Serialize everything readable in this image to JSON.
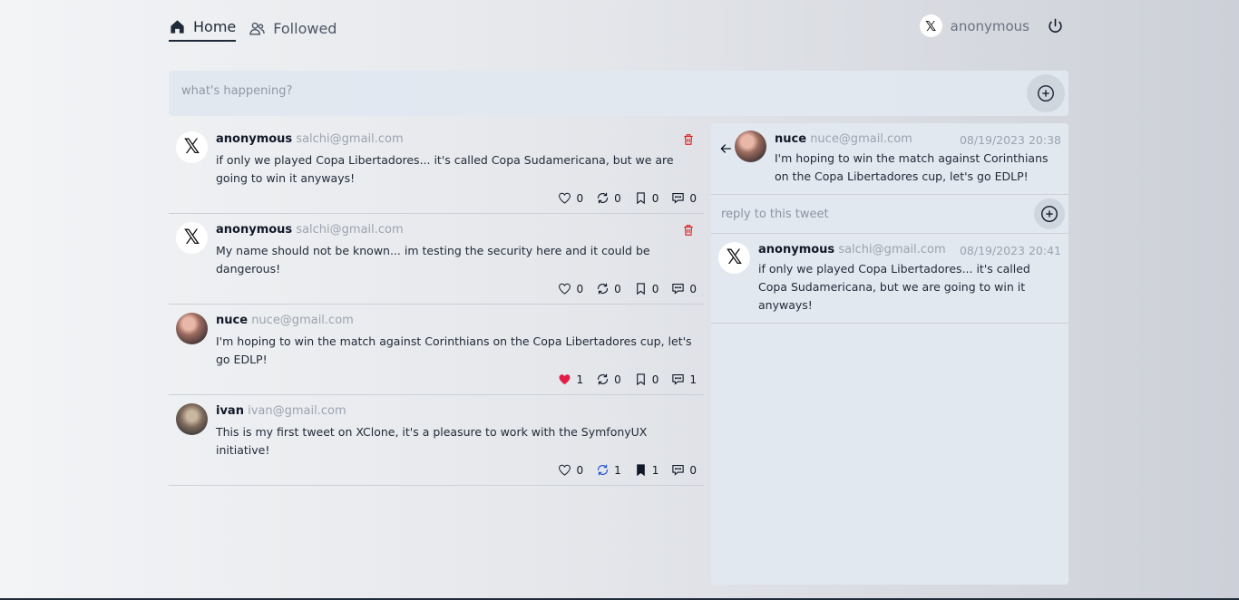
{
  "nav": {
    "home_label": "Home",
    "followed_label": "Followed"
  },
  "user": {
    "avatar_glyph": "𝕏",
    "name": "anonymous"
  },
  "composer": {
    "placeholder": "what's happening?"
  },
  "feed": [
    {
      "avatar": "x",
      "name": "anonymous",
      "email": "salchi@gmail.com",
      "text": "if only we played Copa Libertadores... it's called Copa Sudamericana, but we are going to win it anyways!",
      "likes": "0",
      "retweets": "0",
      "bookmarks": "0",
      "comments": "0",
      "liked": false,
      "retweeted": false,
      "bookmarked": false,
      "deletable": true
    },
    {
      "avatar": "x",
      "name": "anonymous",
      "email": "salchi@gmail.com",
      "text": "My name should not be known... im testing the security here and it could be dangerous!",
      "likes": "0",
      "retweets": "0",
      "bookmarks": "0",
      "comments": "0",
      "liked": false,
      "retweeted": false,
      "bookmarked": false,
      "deletable": true
    },
    {
      "avatar": "photo",
      "name": "nuce",
      "email": "nuce@gmail.com",
      "text": "I'm hoping to win the match against Corinthians on the Copa Libertadores cup, let's go EDLP!",
      "likes": "1",
      "retweets": "0",
      "bookmarks": "0",
      "comments": "1",
      "liked": true,
      "retweeted": false,
      "bookmarked": false,
      "deletable": false
    },
    {
      "avatar": "photo2",
      "name": "ivan",
      "email": "ivan@gmail.com",
      "text": "This is my first tweet on XClone, it's a pleasure to work with the SymfonyUX initiative!",
      "likes": "0",
      "retweets": "1",
      "bookmarks": "1",
      "comments": "0",
      "liked": false,
      "retweeted": true,
      "bookmarked": true,
      "deletable": false
    }
  ],
  "panel": {
    "main": {
      "name": "nuce",
      "email": "nuce@gmail.com",
      "date": "08/19/2023 20:38",
      "text": "I'm hoping to win the match against Corinthians on the Copa Libertadores cup, let's go EDLP!"
    },
    "reply_placeholder": "reply to this tweet",
    "replies": [
      {
        "name": "anonymous",
        "email": "salchi@gmail.com",
        "date": "08/19/2023 20:41",
        "text": "if only we played Copa Libertadores... it's called Copa Sudamericana, but we are going to win it anyways!"
      }
    ]
  },
  "colors": {
    "like_active": "#e11d48",
    "retweet_active": "#1d4ed8",
    "trash": "#dc2626"
  }
}
